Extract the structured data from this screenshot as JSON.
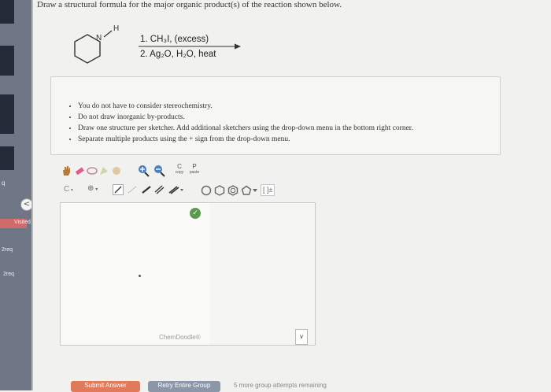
{
  "question": {
    "text": "Draw a structural formula for the major organic product(s) of the reaction shown below."
  },
  "reaction": {
    "reagent_1": "1. CH₃I, (excess)",
    "reagent_2": "2. Ag₂O, H₂O, heat",
    "molecule_atoms": {
      "nitrogen": "N",
      "hydrogen": "H"
    }
  },
  "notes": [
    "You do not have to consider stereochemistry.",
    "Do not draw inorganic by-products.",
    "Draw one structure per sketcher. Add additional sketchers using the drop-down menu in the bottom right corner.",
    "Separate multiple products using the + sign from the drop-down menu."
  ],
  "toolbar": {
    "copy_letter": "C",
    "copy_label": "copy",
    "paste_letter": "P",
    "paste_label": "paste",
    "element_label": "C",
    "charge_label": "⊕",
    "bracket_label": "[ ]±"
  },
  "sketcher": {
    "watermark": "ChemDoodle®",
    "dropdown_icon": "∨",
    "check_icon": "✓"
  },
  "sidebar": {
    "label_q": "q",
    "visited": "Visited",
    "req_1": "2req",
    "req_2": "2req",
    "back_icon": "<"
  },
  "footer": {
    "submit": "Submit Answer",
    "retry": "Retry Entire Group",
    "attempts": "5 more group attempts remaining"
  },
  "colors": {
    "accent_submit": "#e07a5a",
    "retry": "#8b97a8",
    "sidebar": "#6f7686",
    "visited": "#cf6b6b"
  }
}
